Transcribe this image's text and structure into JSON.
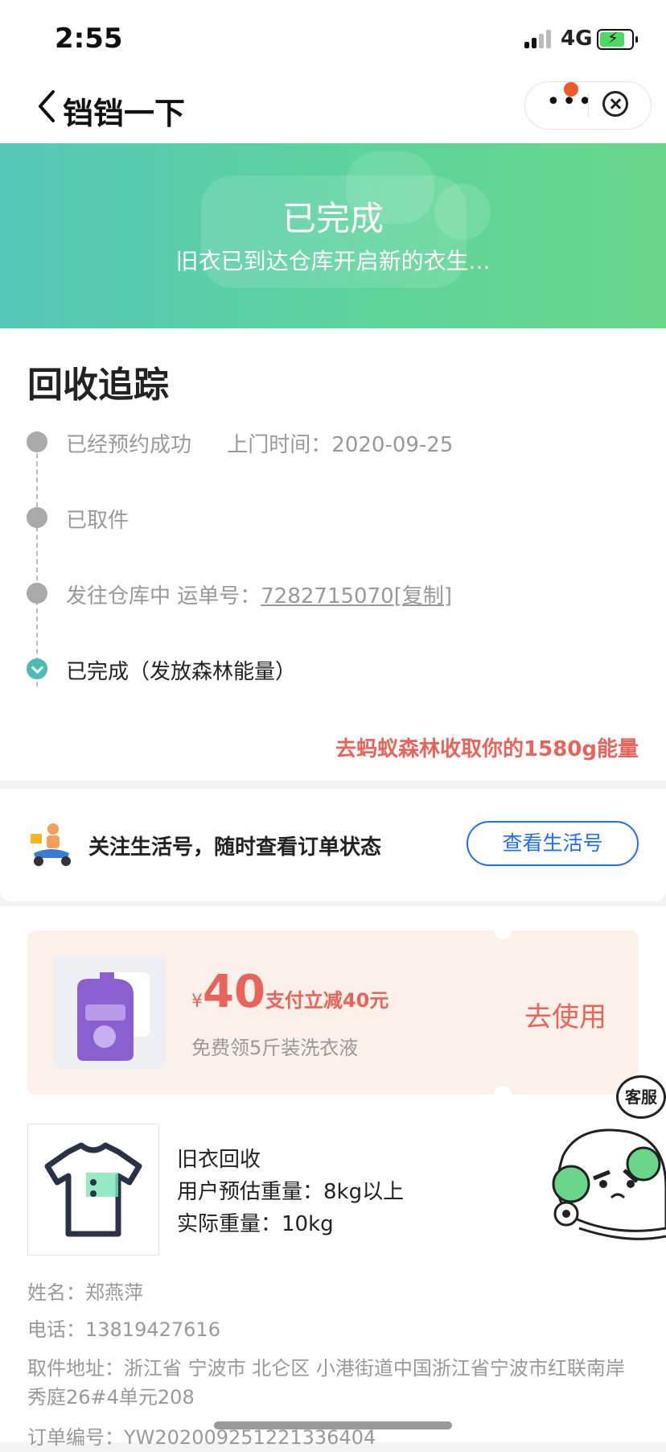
{
  "status_bar": {
    "time": "2:55",
    "network": "4G"
  },
  "nav": {
    "title": "铛铛一下"
  },
  "banner": {
    "title": "已完成",
    "subtitle": "旧衣已到达仓库开启新的衣生..."
  },
  "tracking": {
    "title": "回收追踪",
    "steps": [
      {
        "label": "已经预约成功",
        "extra": "上门时间：2020-09-25"
      },
      {
        "label": "已取件"
      },
      {
        "label": "发往仓库中 运单号：",
        "waybill": "7282715070",
        "copy": "[复制]"
      },
      {
        "label": "已完成（发放森林能量）"
      }
    ],
    "energy_link": "去蚂蚁森林收取你的1580g能量"
  },
  "follow": {
    "text": "关注生活号，随时查看订单状态",
    "button": "查看生活号"
  },
  "coupon": {
    "currency": "¥",
    "amount": "40",
    "desc": "支付立减40元",
    "sub": "免费领5斤装洗衣液",
    "action": "去使用"
  },
  "product": {
    "name": "旧衣回收",
    "estimated": "用户预估重量：8kg以上",
    "actual": "实际重量：10kg"
  },
  "details": {
    "name": "姓名：郑燕萍",
    "phone": "电话：13819427616",
    "address": "取件地址：浙江省 宁波市 北仑区 小港街道中国浙江省宁波市红联南岸秀庭26#4单元208",
    "order": "订单编号：YW202009251221336404"
  },
  "customer_service": {
    "label": "客服"
  },
  "colors": {
    "accent_green": "#5dd49c",
    "energy_red": "#e8645a",
    "link_blue": "#1e6ff0"
  }
}
